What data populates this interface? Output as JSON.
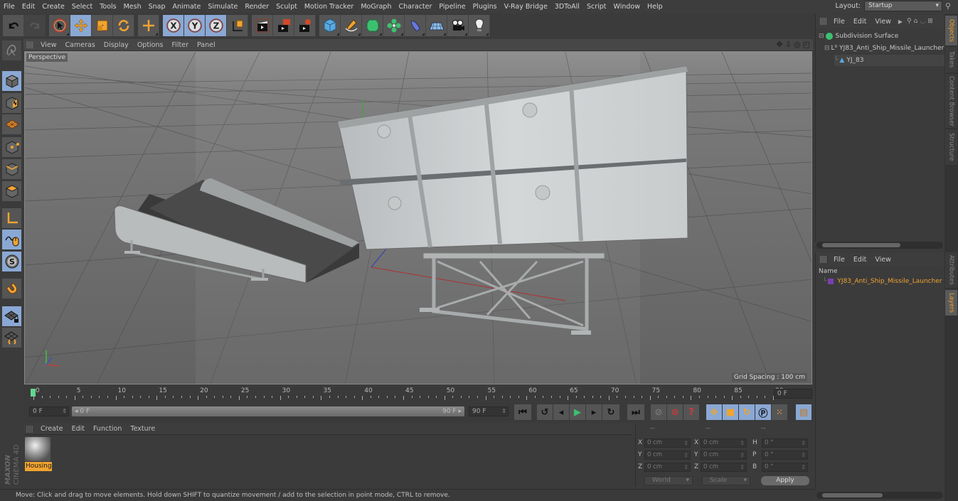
{
  "menu": [
    "File",
    "Edit",
    "Create",
    "Select",
    "Tools",
    "Mesh",
    "Snap",
    "Animate",
    "Simulate",
    "Render",
    "Sculpt",
    "Motion Tracker",
    "MoGraph",
    "Character",
    "Pipeline",
    "Plugins",
    "V-Ray Bridge",
    "3DToAll",
    "Script",
    "Window",
    "Help"
  ],
  "layout": {
    "label": "Layout:",
    "value": "Startup"
  },
  "toolbar": {
    "groups": [
      [
        {
          "icon": "undo-icon"
        },
        {
          "icon": "redo-icon",
          "disabled": true
        }
      ],
      [
        {
          "icon": "live-selection-icon"
        },
        {
          "icon": "move-icon",
          "active": true
        },
        {
          "icon": "scale-icon"
        },
        {
          "icon": "rotate-icon"
        }
      ],
      [
        {
          "icon": "recent-tool-icon"
        }
      ],
      [
        {
          "icon": "x-axis-icon",
          "active": true,
          "label": "X"
        },
        {
          "icon": "y-axis-icon",
          "active": true,
          "label": "Y"
        },
        {
          "icon": "z-axis-icon",
          "active": true,
          "label": "Z"
        },
        {
          "icon": "coordinate-system-icon"
        }
      ],
      [
        {
          "icon": "render-view-icon"
        },
        {
          "icon": "render-to-picture-viewer-icon"
        },
        {
          "icon": "render-settings-icon"
        }
      ],
      [
        {
          "icon": "cube-icon"
        },
        {
          "icon": "pen-spline-icon"
        },
        {
          "icon": "subdivision-surface-icon"
        },
        {
          "icon": "cloner-icon"
        },
        {
          "icon": "deformer-icon"
        },
        {
          "icon": "floor-icon"
        },
        {
          "icon": "camera-icon"
        },
        {
          "icon": "light-icon"
        }
      ]
    ]
  },
  "left_tools": [
    "make-editable-icon",
    "model-mode-icon",
    "texture-mode-icon",
    "workplane-mode-icon",
    "points-mode-icon",
    "edges-mode-icon",
    "polygons-mode-icon",
    "axis-mode-icon",
    "tweak-mode-icon",
    "solo-mode-icon",
    "snap-icon",
    "workplane-lock-icon",
    "planar-workplane-icon"
  ],
  "viewport": {
    "menu": [
      "View",
      "Cameras",
      "Display",
      "Options",
      "Filter",
      "Panel"
    ],
    "camera_label": "Perspective",
    "grid_spacing": "Grid Spacing : 100 cm",
    "nav_icons": [
      "move-view-icon",
      "zoom-view-icon",
      "rotate-view-icon",
      "maximize-view-icon"
    ]
  },
  "timeline": {
    "ticks": [
      "0",
      "5",
      "10",
      "15",
      "20",
      "25",
      "30",
      "35",
      "40",
      "45",
      "50",
      "55",
      "60",
      "65",
      "70",
      "75",
      "80",
      "85",
      "90"
    ],
    "current_frame": "0 F",
    "start_field": "0 F",
    "range_start": "0 F",
    "range_end": "90 F",
    "end_field": "90 F"
  },
  "transport": [
    "go-to-start-icon",
    "previous-keyframe-icon",
    "previous-frame-icon",
    "play-icon",
    "next-frame-icon",
    "next-keyframe-icon",
    "go-to-end-icon",
    "record-active-objects-icon",
    "autokeying-icon",
    "keyframe-selection-icon",
    "position-key-icon",
    "scale-key-icon",
    "rotation-key-icon",
    "parameter-key-icon",
    "point-level-animation-icon",
    "timeline-icon"
  ],
  "material_manager": {
    "menu": [
      "Create",
      "Edit",
      "Function",
      "Texture"
    ],
    "materials": [
      {
        "name": "Housing"
      }
    ]
  },
  "coordinates": {
    "headers": [
      "--",
      "--",
      "--"
    ],
    "rows": [
      {
        "a": "X",
        "av": "0 cm",
        "b": "X",
        "bv": "0 cm",
        "c": "H",
        "cv": "0 °"
      },
      {
        "a": "Y",
        "av": "0 cm",
        "b": "Y",
        "bv": "0 cm",
        "c": "P",
        "cv": "0 °"
      },
      {
        "a": "Z",
        "av": "0 cm",
        "b": "Z",
        "bv": "0 cm",
        "c": "B",
        "cv": "0 °"
      }
    ],
    "mode": "World",
    "size_mode": "Scale",
    "apply": "Apply"
  },
  "status": "Move: Click and drag to move elements. Hold down SHIFT to quantize movement / add to the selection in point mode, CTRL to remove.",
  "objects_panel": {
    "menu": [
      "File",
      "Edit",
      "View"
    ],
    "tree": [
      {
        "name": "Subdivision Surface",
        "depth": 0
      },
      {
        "name": "YJ83_Anti_Ship_Missile_Launcher",
        "depth": 1
      },
      {
        "name": "YJ_83",
        "depth": 2
      }
    ]
  },
  "layers_panel": {
    "menu": [
      "File",
      "Edit",
      "View"
    ],
    "column": "Name",
    "layers": [
      {
        "name": "YJ83_Anti_Ship_Missile_Launcher",
        "color": "#7a3fb0"
      }
    ]
  },
  "side_tabs": [
    {
      "label": "Objects",
      "active": true
    },
    {
      "label": "Takes"
    },
    {
      "label": "Content Browser"
    },
    {
      "label": "Structure"
    },
    {
      "label": "Attributes"
    },
    {
      "label": "Layers",
      "active": true
    }
  ],
  "branding": "MAXON CINEMA 4D",
  "colors": {
    "accent": "#f0a431",
    "active_button": "#8aa8d4",
    "playhead": "#5fd890"
  }
}
